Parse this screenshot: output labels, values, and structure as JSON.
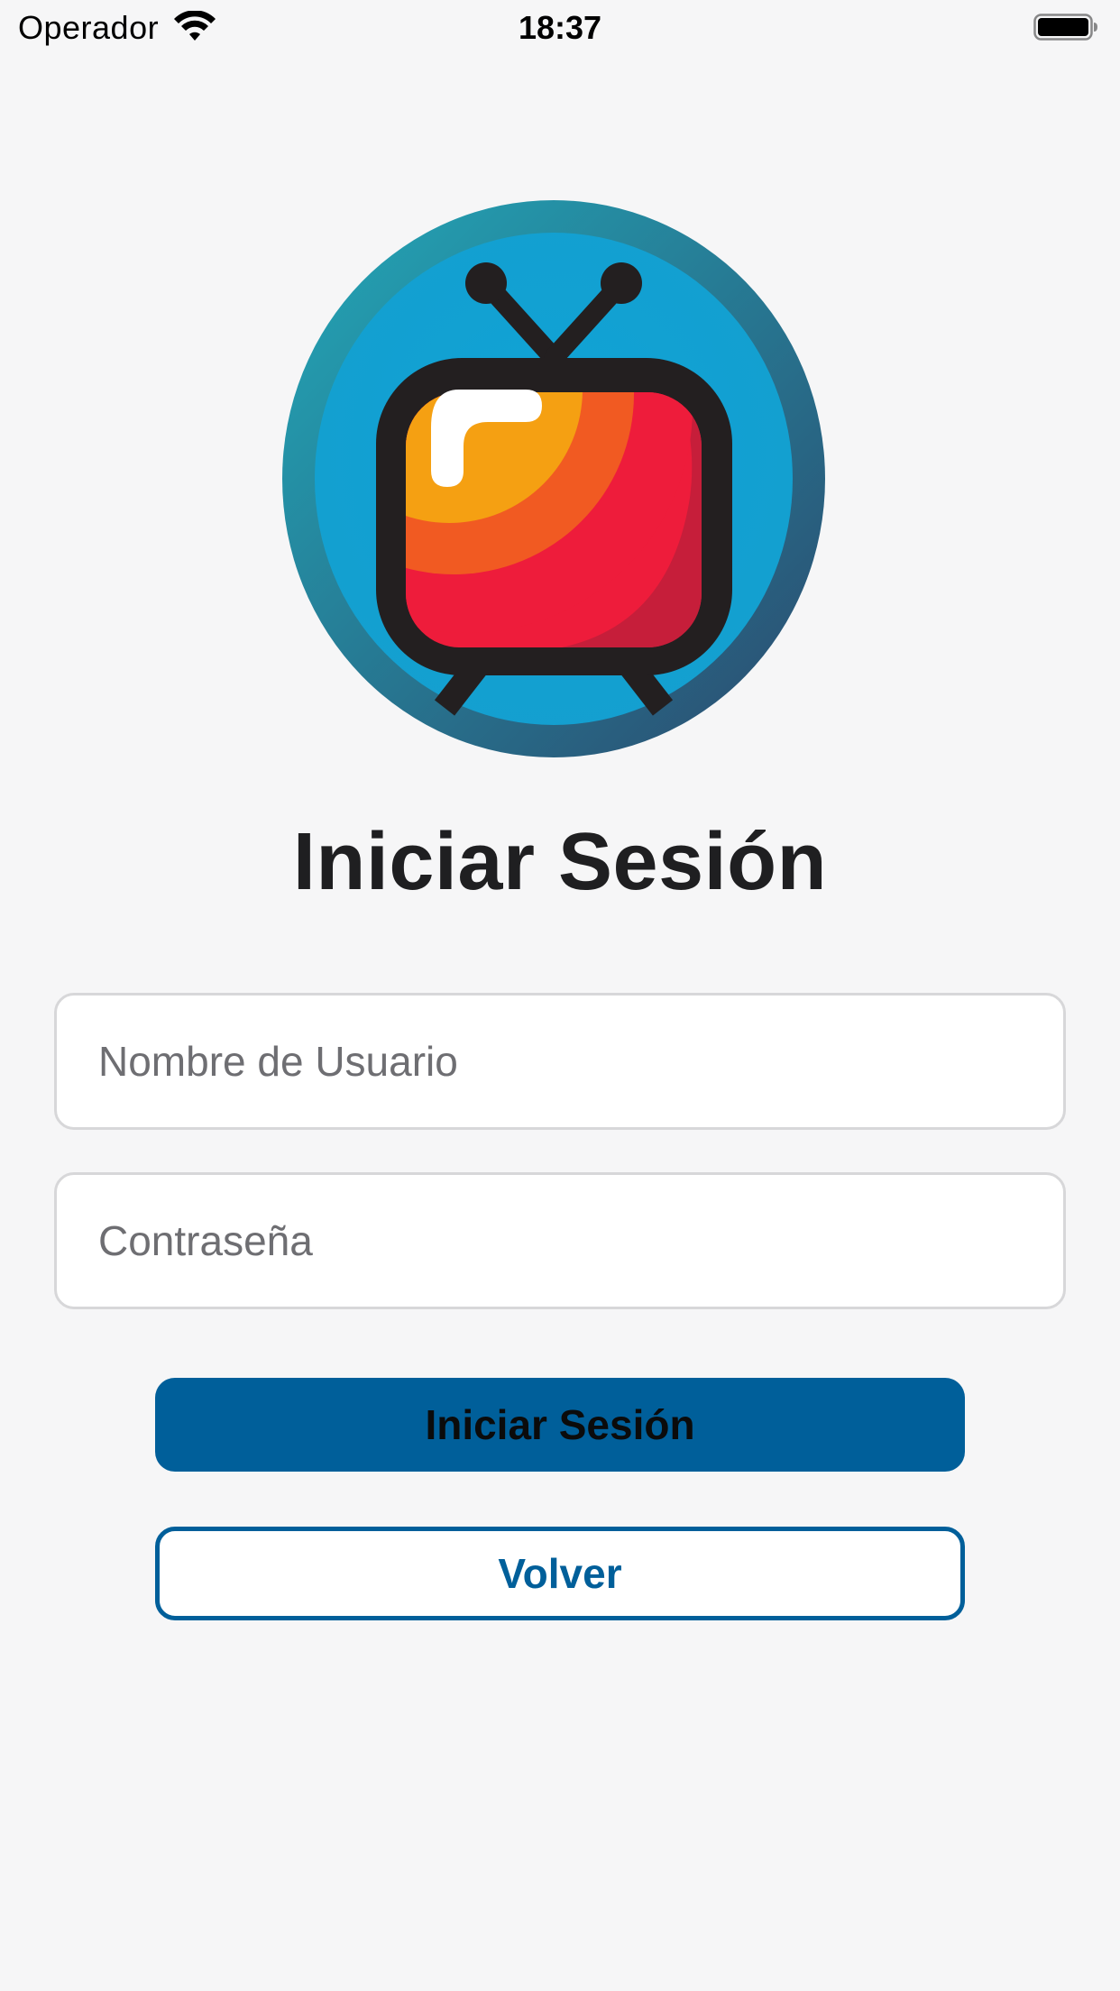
{
  "status_bar": {
    "carrier": "Operador",
    "time": "18:37",
    "wifi_icon": "wifi-icon",
    "battery_icon": "battery-full-icon"
  },
  "logo": {
    "icon": "retro-tv-logo-icon"
  },
  "login": {
    "title": "Iniciar Sesión",
    "username_placeholder": "Nombre de Usuario",
    "username_value": "",
    "password_placeholder": "Contraseña",
    "password_value": "",
    "submit_label": "Iniciar Sesión",
    "back_label": "Volver"
  },
  "colors": {
    "background": "#f6f6f7",
    "accent": "#005f9a",
    "title_text": "#1f1f21",
    "field_border": "#d7d7d9"
  }
}
